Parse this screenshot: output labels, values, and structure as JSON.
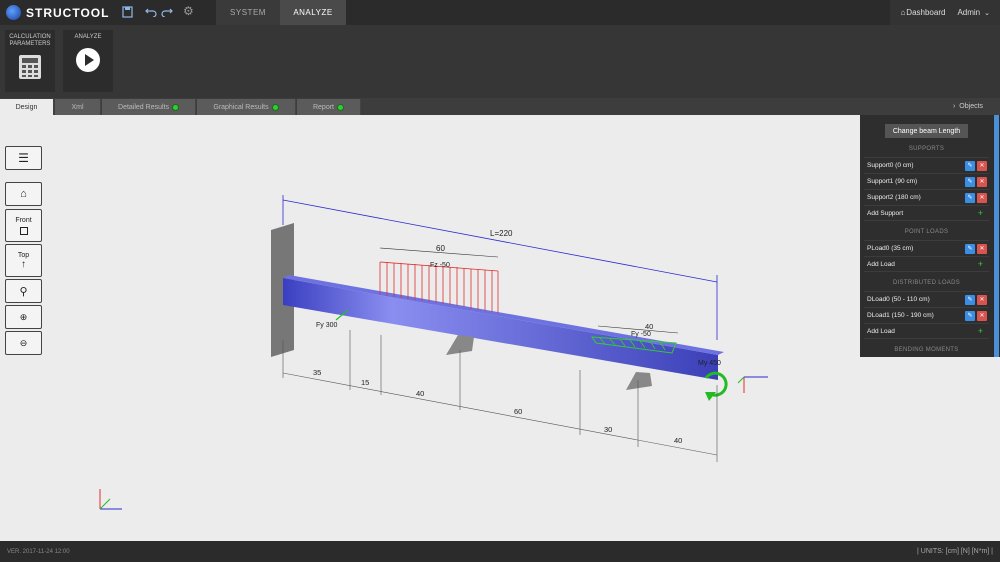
{
  "app": {
    "name": "STRUCTOOL"
  },
  "topbar": {
    "tabs": [
      "SYSTEM",
      "ANALYZE"
    ],
    "links": {
      "dashboard": "Dashboard",
      "admin": "Admin"
    }
  },
  "ribbon": {
    "calc_label": "CALCULATION\nPARAMETERS",
    "analyze_label": "ANALYZE"
  },
  "subtabs": [
    "Design",
    "Xml",
    "Detailed Results",
    "Graphical Results",
    "Report"
  ],
  "objects_label": "Objects",
  "sidebar": {
    "front": "Front",
    "top": "Top"
  },
  "panel": {
    "change_beam": "Change beam Length",
    "supports_title": "SUPPORTS",
    "supports": [
      "Support0 (0 cm)",
      "Support1 (90 cm)",
      "Support2 (180 cm)"
    ],
    "add_support": "Add Support",
    "point_loads_title": "POINT LOADS",
    "point_loads": [
      "PLoad0 (35 cm)"
    ],
    "add_load": "Add Load",
    "dist_loads_title": "DISTRIBUTED LOADS",
    "dist_loads": [
      "DLoad0 (50 - 110 cm)",
      "DLoad1 (150 - 190 cm)"
    ],
    "add_load2": "Add Load",
    "bending_title": "BENDING MOMENTS"
  },
  "scene": {
    "length_label": "L=220",
    "fz_label": "Fz -50",
    "fz_span": "60",
    "fy_label": "Fy 300",
    "fy2_label": "Fy -50",
    "fy2_span": "40",
    "my_label": "My 450",
    "dims": [
      "35",
      "15",
      "40",
      "60",
      "30",
      "40"
    ]
  },
  "footer": {
    "version": "VER. 2017-11-24 12:00",
    "units": "| UNITS: [cm] [N] [N*m] |"
  },
  "colors": {
    "beam": "#4a4fd0",
    "load_red": "#e03030",
    "load_green": "#33cc33",
    "accent": "#4a90d9"
  }
}
